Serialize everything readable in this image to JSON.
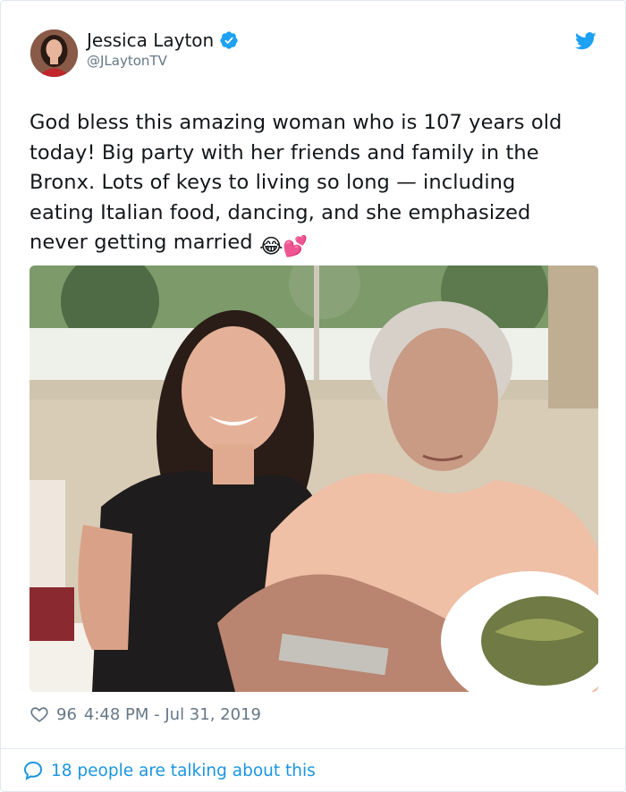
{
  "author": {
    "display_name": "Jessica Layton",
    "handle": "@JLaytonTV",
    "verified": true
  },
  "icons": {
    "verified": "verified-badge-icon",
    "bird": "twitter-bird-icon",
    "heart": "heart-icon",
    "bubble": "speech-bubble-icon"
  },
  "tweet": {
    "text_line1": "God bless this amazing woman who is 107 years old",
    "text_line2": "today! Big party with her friends and family in the",
    "text_line3": "Bronx. Lots of keys to living so long — including",
    "text_line4": "eating Italian food, dancing, and she emphasized",
    "text_line5": "never getting married",
    "emoji_1": "😂",
    "emoji_2": "💕"
  },
  "meta": {
    "like_count": "96",
    "timestamp": "4:48 PM - Jul 31, 2019"
  },
  "footer": {
    "talking_label": "18 people are talking about this"
  },
  "colors": {
    "accent": "#1da1f2",
    "link": "#1b95e0",
    "muted": "#657786",
    "border": "#e1e8ed"
  }
}
